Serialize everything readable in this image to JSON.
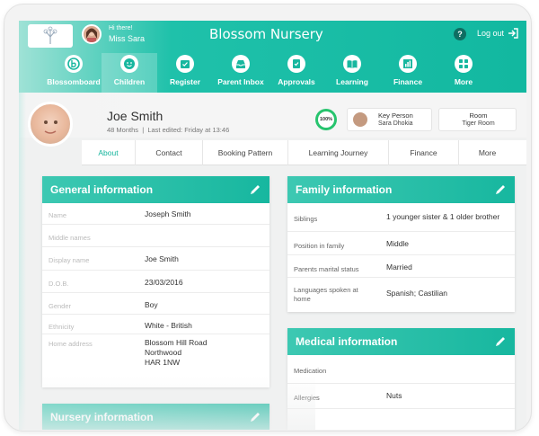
{
  "app": {
    "title": "Blossom Nursery"
  },
  "user": {
    "greeting": "Hi there!",
    "name": "Miss Sara"
  },
  "topbar": {
    "help_label": "?",
    "logout_label": "Log out"
  },
  "nav": [
    {
      "label": "Blossomboard",
      "icon": "blossom-logo-icon"
    },
    {
      "label": "Children",
      "icon": "child-face-icon",
      "active": true
    },
    {
      "label": "Register",
      "icon": "register-icon"
    },
    {
      "label": "Parent Inbox",
      "icon": "inbox-icon"
    },
    {
      "label": "Approvals",
      "icon": "approvals-icon"
    },
    {
      "label": "Learning",
      "icon": "book-icon"
    },
    {
      "label": "Finance",
      "icon": "chart-icon"
    },
    {
      "label": "More",
      "icon": "grid-icon"
    }
  ],
  "child": {
    "name": "Joe Smith",
    "age": "48 Months",
    "edited": "Last edited: Friday at 13:46",
    "completion": "100%"
  },
  "key_person": {
    "heading": "Key Person",
    "name": "Sara Dhokia"
  },
  "room": {
    "heading": "Room",
    "name": "Tiger Room"
  },
  "tabs": [
    "About",
    "Contact",
    "Booking Pattern",
    "Learning Journey",
    "Finance",
    "More"
  ],
  "general": {
    "title": "General information",
    "rows": [
      {
        "label": "Name",
        "value": "Joseph Smith"
      },
      {
        "label": "Middle names",
        "value": ""
      },
      {
        "label": "Display name",
        "value": "Joe Smith"
      },
      {
        "label": "D.O.B.",
        "value": "23/03/2016"
      },
      {
        "label": "Gender",
        "value": "Boy"
      },
      {
        "label": "Ethnicity",
        "value": "White - British"
      },
      {
        "label": "Home address",
        "value_lines": [
          "Blossom Hill Road",
          "Northwood",
          "HAR 1NW"
        ]
      }
    ]
  },
  "family": {
    "title": "Family information",
    "rows": [
      {
        "label": "Siblings",
        "value": "1 younger sister & 1 older brother"
      },
      {
        "label": "Position in family",
        "value": "Middle"
      },
      {
        "label": "Parents marital status",
        "value": "Married"
      },
      {
        "label": "Languages spoken at home",
        "value": "Spanish; Castilian"
      }
    ]
  },
  "medical": {
    "title": "Medical information",
    "rows": [
      {
        "label": "Medication",
        "value": ""
      },
      {
        "label": "Allergies",
        "value": "Nuts"
      }
    ]
  },
  "nursery": {
    "title": "Nursery information"
  },
  "colors": {
    "accent": "#17b79f",
    "accent_light": "#3dc8b2",
    "progress": "#27c46e"
  }
}
